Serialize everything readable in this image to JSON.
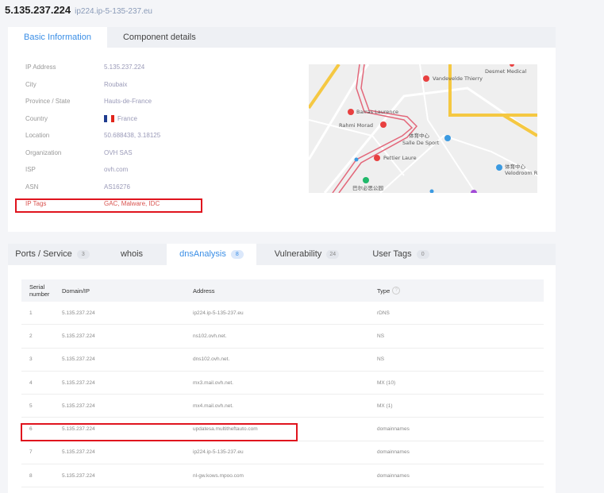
{
  "header": {
    "ip": "5.135.237.224",
    "host": "ip224.ip-5-135-237.eu"
  },
  "top_tabs": [
    {
      "label": "Basic Information"
    },
    {
      "label": "Component details"
    }
  ],
  "info": [
    {
      "key": "IP Address",
      "value": "5.135.237.224"
    },
    {
      "key": "City",
      "value": "Roubaix"
    },
    {
      "key": "Province / State",
      "value": "Hauts-de-France"
    },
    {
      "key": "Country",
      "value": "France"
    },
    {
      "key": "Location",
      "value": "50.688438, 3.18125"
    },
    {
      "key": "Organization",
      "value": "OVH SAS"
    },
    {
      "key": "ISP",
      "value": "ovh.com"
    },
    {
      "key": "ASN",
      "value": "AS16276"
    },
    {
      "key": "IP Tags",
      "value": "GAC, Malware, IDC"
    }
  ],
  "map": {
    "labels": [
      "Desmet Medical",
      "Vandevelde Thierry",
      "Barras Laurence",
      "Rahmi Morad",
      "体育中心",
      "Salle De Sport",
      "Pettier Laure",
      "体育中心",
      "Velodroom Ro",
      "巴尔必思公园"
    ]
  },
  "bottom_tabs": [
    {
      "label": "Ports / Service",
      "badge": "3"
    },
    {
      "label": "whois",
      "badge": ""
    },
    {
      "label": "dnsAnalysis",
      "badge": "8"
    },
    {
      "label": "Vulnerability",
      "badge": "24"
    },
    {
      "label": "User Tags",
      "badge": "0"
    }
  ],
  "table": {
    "headers": [
      "Serial number",
      "Domain/IP",
      "Address",
      "Type"
    ],
    "rows": [
      {
        "n": "1",
        "domain": "5.135.237.224",
        "address": "ip224.ip-5-135-237.eu",
        "type": "rDNS"
      },
      {
        "n": "2",
        "domain": "5.135.237.224",
        "address": "ns102.ovh.net.",
        "type": "NS"
      },
      {
        "n": "3",
        "domain": "5.135.237.224",
        "address": "dns102.ovh.net.",
        "type": "NS"
      },
      {
        "n": "4",
        "domain": "5.135.237.224",
        "address": "mx3.mail.ovh.net.",
        "type": "MX (10)"
      },
      {
        "n": "5",
        "domain": "5.135.237.224",
        "address": "mx4.mail.ovh.net.",
        "type": "MX (1)"
      },
      {
        "n": "6",
        "domain": "5.135.237.224",
        "address": "updatesa.multitheftauto.com",
        "type": "domainnames"
      },
      {
        "n": "7",
        "domain": "5.135.237.224",
        "address": "ip224.ip-5-135-237.eu",
        "type": "domainnames"
      },
      {
        "n": "8",
        "domain": "5.135.237.224",
        "address": "nl-gw.kows.mpoo.com",
        "type": "domainnames"
      }
    ]
  },
  "colors": {
    "accent": "#3a8ee6",
    "highlight": "#e0141e",
    "tag_text": "#d9534f"
  }
}
